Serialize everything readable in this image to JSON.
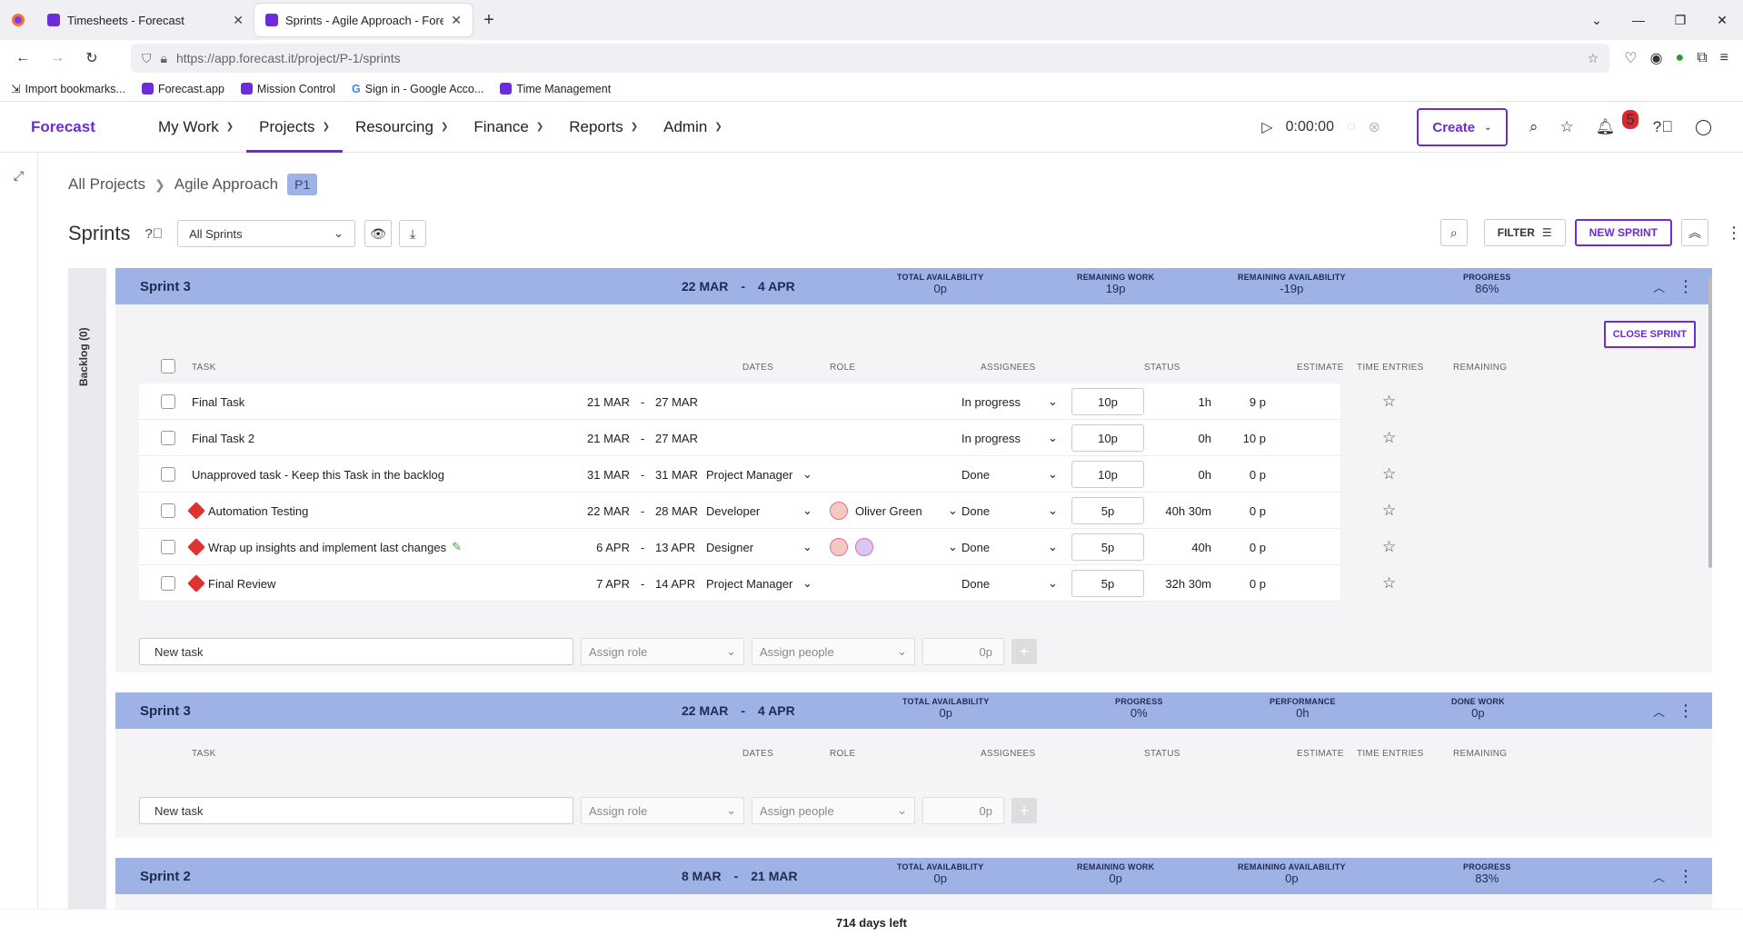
{
  "browser": {
    "tabs": [
      {
        "title": "Timesheets - Forecast",
        "active": false
      },
      {
        "title": "Sprints - Agile Approach - Forec",
        "active": true
      }
    ],
    "url": "https://app.forecast.it/project/P-1/sprints",
    "bookmarks": [
      "Import bookmarks...",
      "Forecast.app",
      "Mission Control",
      "Sign in - Google Acco...",
      "Time Management"
    ]
  },
  "header": {
    "brand": "Forecast",
    "nav": [
      "My Work",
      "Projects",
      "Resourcing",
      "Finance",
      "Reports",
      "Admin"
    ],
    "active_nav": "Projects",
    "timer": "0:00:00",
    "create_label": "Create",
    "notification_count": "5"
  },
  "breadcrumb": {
    "all_projects": "All Projects",
    "project": "Agile Approach",
    "project_id": "P1"
  },
  "toolbar": {
    "title": "Sprints",
    "filter_select": "All Sprints",
    "filter_label": "FILTER",
    "new_sprint_label": "NEW SPRINT"
  },
  "backlog_label": "Backlog (0)",
  "columns": {
    "task": "TASK",
    "dates": "DATES",
    "role": "ROLE",
    "assignees": "ASSIGNEES",
    "status": "STATUS",
    "estimate": "ESTIMATE",
    "time_entries": "TIME ENTRIES",
    "remaining": "REMAINING"
  },
  "sprints": [
    {
      "name": "Sprint 3",
      "start": "22 MAR",
      "end": "4 APR",
      "stats": [
        {
          "label": "TOTAL AVAILABILITY",
          "value": "0p"
        },
        {
          "label": "REMAINING WORK",
          "value": "19p"
        },
        {
          "label": "REMAINING AVAILABILITY",
          "value": "-19p"
        },
        {
          "label": "PROGRESS",
          "value": "86%"
        }
      ],
      "close_label": "CLOSE SPRINT",
      "tasks": [
        {
          "name": "Final Task",
          "start": "21 MAR",
          "end": "27 MAR",
          "role": "",
          "assignee": "",
          "status": "In progress",
          "estimate": "10p",
          "time": "1h",
          "remaining": "9 p",
          "warning": false
        },
        {
          "name": "Final Task 2",
          "start": "21 MAR",
          "end": "27 MAR",
          "role": "",
          "assignee": "",
          "status": "In progress",
          "estimate": "10p",
          "time": "0h",
          "remaining": "10 p",
          "warning": false
        },
        {
          "name": "Unapproved task - Keep this Task in the backlog",
          "start": "31 MAR",
          "end": "31 MAR",
          "role": "Project Manager",
          "assignee": "",
          "status": "Done",
          "estimate": "10p",
          "time": "0h",
          "remaining": "0 p",
          "warning": false
        },
        {
          "name": "Automation Testing",
          "start": "22 MAR",
          "end": "28 MAR",
          "role": "Developer",
          "assignee": "Oliver Green",
          "status": "Done",
          "estimate": "5p",
          "time": "40h 30m",
          "remaining": "0 p",
          "warning": true
        },
        {
          "name": "Wrap up insights and implement last changes",
          "start": "6 APR",
          "end": "13 APR",
          "role": "Designer",
          "assignee": "",
          "status": "Done",
          "estimate": "5p",
          "time": "40h",
          "remaining": "0 p",
          "warning": true
        },
        {
          "name": "Final Review",
          "start": "7 APR",
          "end": "14 APR",
          "role": "Project Manager",
          "assignee": "",
          "status": "Done",
          "estimate": "5p",
          "time": "32h 30m",
          "remaining": "0 p",
          "warning": true
        }
      ]
    },
    {
      "name": "Sprint 3",
      "start": "22 MAR",
      "end": "4 APR",
      "stats": [
        {
          "label": "TOTAL AVAILABILITY",
          "value": "0p"
        },
        {
          "label": "PROGRESS",
          "value": "0%"
        },
        {
          "label": "PERFORMANCE",
          "value": "0h"
        },
        {
          "label": "DONE WORK",
          "value": "0p"
        }
      ]
    },
    {
      "name": "Sprint 2",
      "start": "8 MAR",
      "end": "21 MAR",
      "stats": [
        {
          "label": "TOTAL AVAILABILITY",
          "value": "0p"
        },
        {
          "label": "REMAINING WORK",
          "value": "0p"
        },
        {
          "label": "REMAINING AVAILABILITY",
          "value": "0p"
        },
        {
          "label": "PROGRESS",
          "value": "83%"
        }
      ]
    }
  ],
  "new_task": {
    "placeholder": "New task",
    "assign_role": "Assign role",
    "assign_people": "Assign people",
    "estimate": "0p"
  },
  "footer": "714 days left"
}
